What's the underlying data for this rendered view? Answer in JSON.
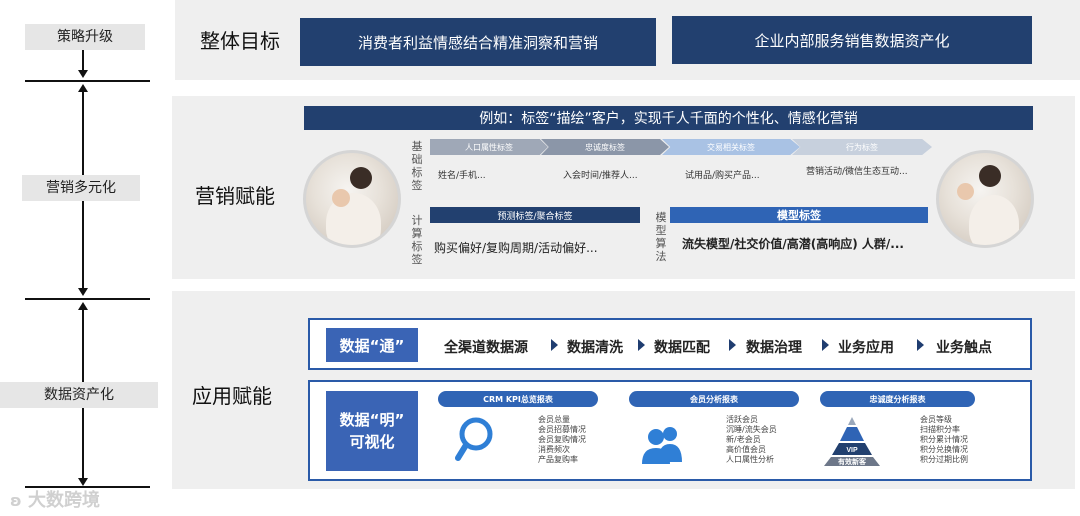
{
  "left_axis": {
    "labels": [
      "策略升级",
      "营销多元化",
      "数据资产化"
    ]
  },
  "top": {
    "title": "整体目标",
    "goals": [
      "消费者利益情感结合精准洞察和营销",
      "企业内部服务销售数据资产化"
    ]
  },
  "middle": {
    "title": "营销赋能",
    "banner": "例如：标签“描绘”客户，实现千人千面的个性化、情感化营销",
    "basic_label": "基础标签",
    "basic_tags": [
      {
        "label": "人口属性标签",
        "value": "姓名/手机..."
      },
      {
        "label": "忠诚度标签",
        "value": "入会时间/推荐人..."
      },
      {
        "label": "交易相关标签",
        "value": "试用品/购买产品..."
      },
      {
        "label": "行为标签",
        "value": "营销活动/微信生态互动..."
      }
    ],
    "calc_label": "计算标签",
    "calc_tag": "预测标签/聚合标签",
    "calc_value": "购买偏好/复购周期/活动偏好...",
    "model_label": "模型算法",
    "model_tag": "模型标签",
    "model_value": "流失模型/社交价值/高潜(高响应)  人群/..."
  },
  "bottom": {
    "title": "应用赋能",
    "row1_tag": "数据“通”",
    "flow": [
      "全渠道数据源",
      "数据清洗",
      "数据匹配",
      "数据治理",
      "业务应用",
      "业务触点"
    ],
    "row2_tag_line1": "数据“明”",
    "row2_tag_line2": "可视化",
    "reports": [
      {
        "title": "CRM KPI总览报表",
        "icon": "magnifier-icon",
        "items": [
          "会员总量",
          "会员招募情况",
          "会员复购情况",
          "消费频次",
          "产品复购率"
        ]
      },
      {
        "title": "会员分析报表",
        "icon": "users-icon",
        "items": [
          "活跃会员",
          "沉睡/流失会员",
          "新/老会员",
          "高价值会员",
          "人口属性分析"
        ]
      },
      {
        "title": "忠诚度分析报表",
        "icon": "vip-pyramid-icon",
        "pyramid_top": "VIP",
        "pyramid_bottom": "有效新客",
        "items": [
          "会员等级",
          "扫描积分率",
          "积分累计情况",
          "积分兑换情况",
          "积分过期比例"
        ]
      }
    ]
  },
  "watermark": "大数跨境",
  "colors": {
    "navy": "#22406f",
    "blue": "#2f64b5",
    "panel": "#efefef"
  }
}
